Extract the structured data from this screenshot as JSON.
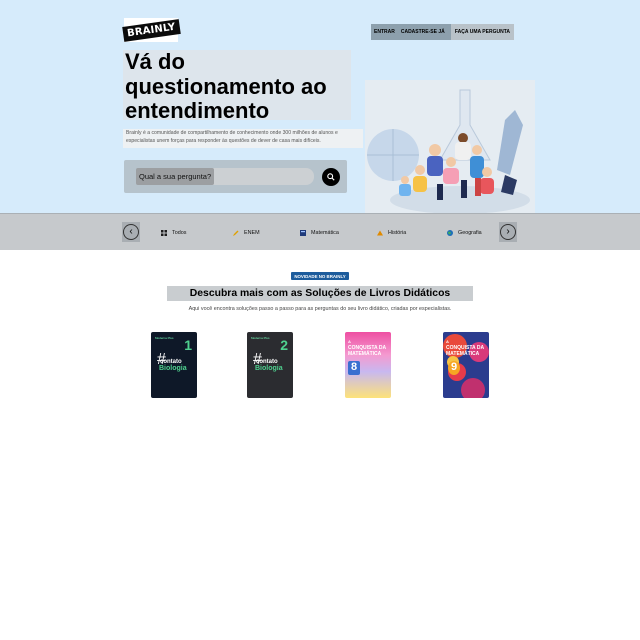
{
  "header": {
    "logo_text": "BRAINLY",
    "nav": [
      "ENTRAR",
      "CADASTRE-SE JÁ",
      "FAÇA UMA PERGUNTA"
    ]
  },
  "hero": {
    "headline_line1": "Vá do",
    "headline_line2": "questionamento ao",
    "headline_line3": "entendimento",
    "description": "Brainly é a comunidade de compartilhamento de conhecimento onde 300 milhões de alunos e especialistas unem forças para responder às questões de dever de casa mais difíceis.",
    "search_placeholder": "Qual a sua pergunta?"
  },
  "categories": [
    {
      "label": "Todos",
      "icon": "grid-icon",
      "color": "#1c1c1c"
    },
    {
      "label": "ENEM",
      "icon": "pencil-icon",
      "color": "#e0a100"
    },
    {
      "label": "Matemática",
      "icon": "calculator-icon",
      "color": "#1f3a7a"
    },
    {
      "label": "História",
      "icon": "pyramid-icon",
      "color": "#e08a00"
    },
    {
      "label": "Geografia",
      "icon": "globe-icon",
      "color": "#1d6fb8"
    }
  ],
  "section": {
    "badge": "NOVIDADE NO BRAINLY",
    "title": "Descubra mais com as Soluções de Livros Didáticos",
    "subtitle": "Aqui você encontra soluções passo a passo para as perguntas do seu livro didático, criadas por especialistas."
  },
  "books": [
    {
      "series": "Moderna Plus",
      "number": "1",
      "title_top": "contato",
      "title_bottom": "Biologia"
    },
    {
      "series": "Moderna Plus",
      "number": "2",
      "title_top": "contato",
      "title_bottom": "Biologia"
    },
    {
      "series": "A",
      "title": "CONQUISTA DA MATEMÁTICA",
      "number": "8"
    },
    {
      "series": "A",
      "title": "CONQUISTA DA MATEMÁTICA",
      "number": "9"
    }
  ],
  "colors": {
    "hero_bg": "#d6ebfb",
    "badge_bg": "#1d5c9c"
  }
}
